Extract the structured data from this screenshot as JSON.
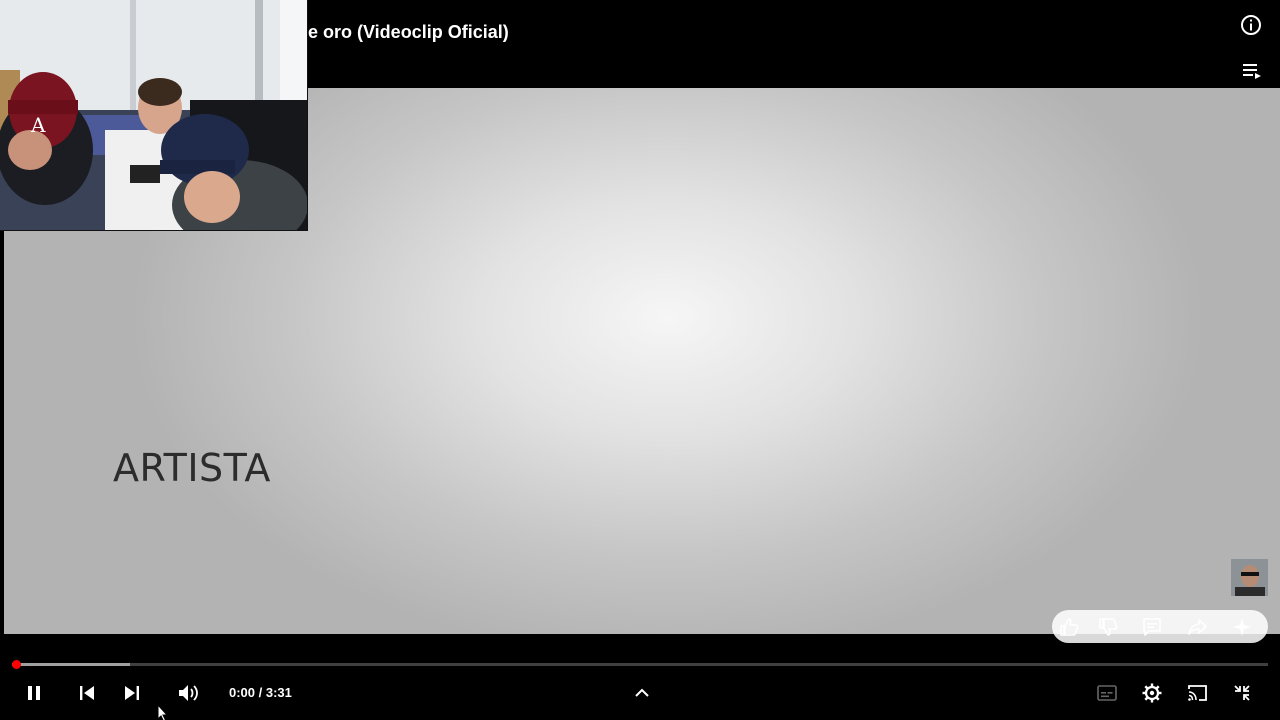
{
  "player": {
    "title": "e oro (Videoclip Oficial)",
    "video_text": "ARTISTA",
    "current_time": "0:00",
    "duration": "3:31",
    "time_display": "0:00 / 3:31",
    "progress_fraction": 0.0,
    "buffered_fraction": 0.094
  },
  "icons": {
    "info": "info-icon",
    "queue": "queue-icon",
    "like": "thumb-up-icon",
    "dislike": "thumb-down-icon",
    "comments": "comment-icon",
    "share": "share-icon",
    "ask": "sparkle-icon",
    "pause": "pause-icon",
    "previous": "skip-previous-icon",
    "next": "skip-next-icon",
    "volume": "volume-icon",
    "expand": "chevron-up-icon",
    "captions": "captions-icon",
    "settings": "gear-icon",
    "cast": "cast-icon",
    "exit_fullscreen": "exit-fullscreen-icon"
  },
  "colors": {
    "accent": "#ff0000",
    "background": "#000000",
    "video_text": "#2c2c2c"
  }
}
